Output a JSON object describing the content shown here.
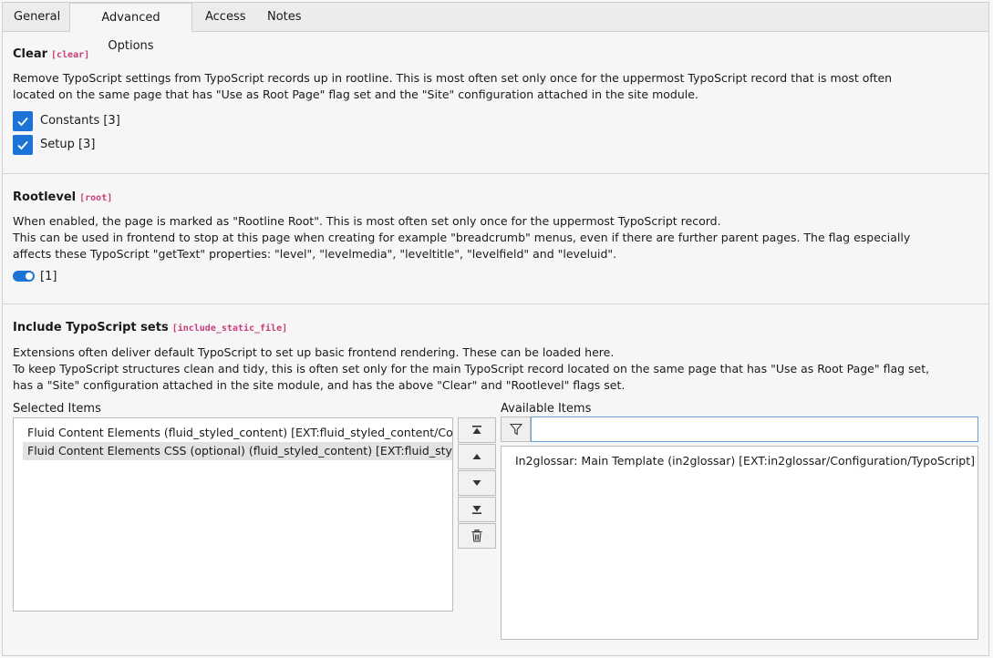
{
  "tabs": [
    "General",
    "Advanced Options",
    "Access",
    "Notes"
  ],
  "clear": {
    "title": "Clear",
    "code": "[clear]",
    "description_lines": [
      "Remove TypoScript settings from TypoScript records up in rootline. This is most often set only once for the uppermost TypoScript record that is most often",
      "located on the same page that has \"Use as Root Page\" flag set and the \"Site\" configuration attached in the site module."
    ],
    "options": [
      {
        "label": "Constants [3]",
        "checked": true
      },
      {
        "label": "Setup [3]",
        "checked": true
      }
    ]
  },
  "rootlevel": {
    "title": "Rootlevel",
    "code": "[root]",
    "description_lines": [
      "When enabled, the page is marked as \"Rootline Root\". This is most often set only once for the uppermost TypoScript record.",
      "This can be used in frontend to stop at this page when creating for example \"breadcrumb\" menus, even if there are further parent pages. The flag especially",
      "affects these TypoScript \"getText\" properties: \"level\", \"levelmedia\", \"leveltitle\", \"levelfield\" and \"leveluid\"."
    ],
    "toggle_label": "[1]",
    "toggle_on": true
  },
  "include": {
    "title": "Include TypoScript sets",
    "code": "[include_static_file]",
    "description_lines": [
      "Extensions often deliver default TypoScript to set up basic frontend rendering. These can be loaded here.",
      "To keep TypoScript structures clean and tidy, this is often set only for the main TypoScript record located on the same page that has \"Use as Root Page\" flag set,",
      "has a \"Site\" configuration attached in the site module, and has the above \"Clear\" and \"Rootlevel\" flags set."
    ],
    "selected_label": "Selected Items",
    "available_label": "Available Items",
    "selected_items": [
      "Fluid Content Elements (fluid_styled_content) [EXT:fluid_styled_content/Con",
      "Fluid Content Elements CSS (optional) (fluid_styled_content) [EXT:fluid_style"
    ],
    "available_items": [
      "In2glossar: Main Template (in2glossar) [EXT:in2glossar/Configuration/TypoScript]"
    ],
    "filter_value": "",
    "controls": [
      "move-to-top",
      "move-up",
      "move-down",
      "move-to-bottom",
      "remove"
    ]
  },
  "colors": {
    "accent": "#1b73d5",
    "code": "#c83c7a"
  }
}
